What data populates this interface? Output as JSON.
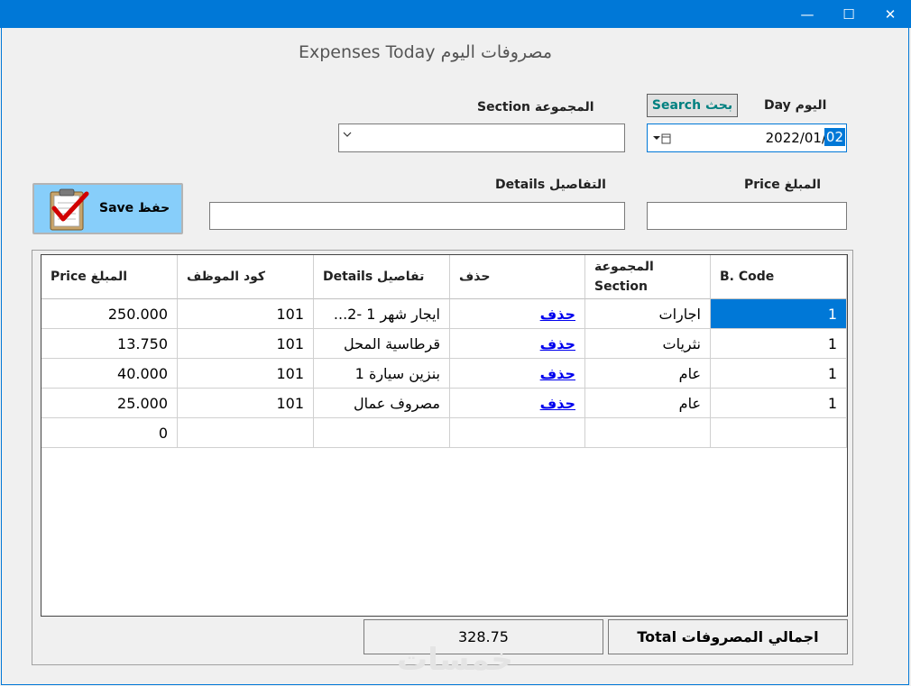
{
  "window": {
    "minimize_glyph": "—",
    "maximize_glyph": "☐",
    "close_glyph": "✕",
    "accent": "#0078d7"
  },
  "form": {
    "title": "مصروفات اليوم  Expenses Today",
    "day_label": "اليوم Day",
    "search_label": "بحث Search",
    "section_label": "المجموعة Section",
    "date_value_prefix": "2022/01/",
    "date_value_selected": "02",
    "price_label": "المبلغ Price",
    "details_label": "التفاصيل Details",
    "save_label": "حفظ Save",
    "save_color": "#87cefa",
    "search_color": "#008080"
  },
  "grid": {
    "headers": {
      "bcode": "B. Code",
      "section_line1": "المجموعة",
      "section_line2": "Section",
      "delete": "حذف",
      "details": "تفاصيل Details",
      "employee_code": "كود الموظف",
      "price": "المبلغ Price"
    },
    "rows": [
      {
        "bcode": "1",
        "section": "اجارات",
        "delete": "حذف",
        "details": "ايجار شهر 1 -2...",
        "employee_code": "101",
        "price": "250.000"
      },
      {
        "bcode": "1",
        "section": "نثريات",
        "delete": "حذف",
        "details": "قرطاسية المحل",
        "employee_code": "101",
        "price": "13.750"
      },
      {
        "bcode": "1",
        "section": "عام",
        "delete": "حذف",
        "details": "بنزين سيارة 1",
        "employee_code": "101",
        "price": "40.000"
      },
      {
        "bcode": "1",
        "section": "عام",
        "delete": "حذف",
        "details": "مصروف عمال",
        "employee_code": "101",
        "price": "25.000"
      }
    ],
    "new_row_price": "0",
    "selection_color": "#0078d7"
  },
  "totals": {
    "label": "اجمالي المصروفات Total",
    "value": "328.75"
  },
  "watermark": "خمسات"
}
